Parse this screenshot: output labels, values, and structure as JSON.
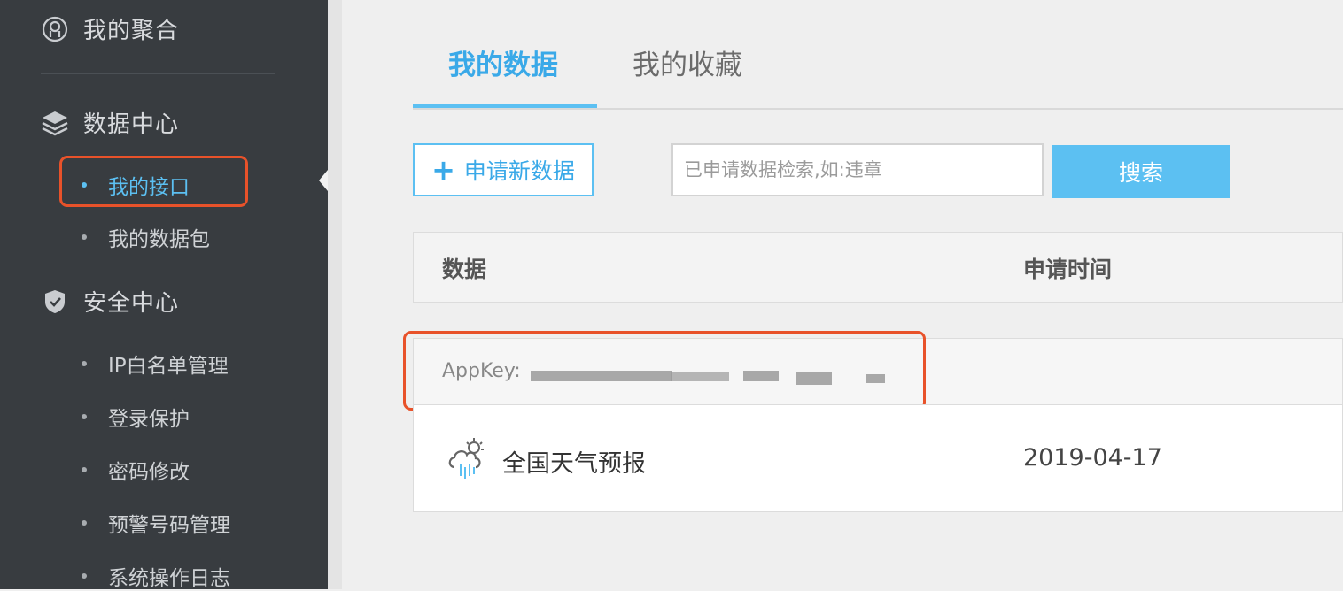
{
  "sidebar": {
    "my_aggregation": "我的聚合",
    "data_center": {
      "title": "数据中心",
      "items": [
        "我的接口",
        "我的数据包"
      ]
    },
    "security_center": {
      "title": "安全中心",
      "items": [
        "IP白名单管理",
        "登录保护",
        "密码修改",
        "预警号码管理",
        "系统操作日志"
      ]
    }
  },
  "tabs": [
    "我的数据",
    "我的收藏"
  ],
  "toolbar": {
    "apply_label": "申请新数据",
    "search_placeholder": "已申请数据检索,如:违章",
    "search_label": "搜索"
  },
  "table": {
    "headers": [
      "数据",
      "申请时间"
    ],
    "appkey_label": "AppKey:",
    "rows": [
      {
        "icon": "weather-cloud-sun-rain-icon",
        "name": "全国天气预报",
        "date": "2019-04-17"
      }
    ]
  },
  "colors": {
    "accent": "#5cc0f2",
    "sidebar_bg": "#383c40",
    "highlight": "#e8522a"
  }
}
